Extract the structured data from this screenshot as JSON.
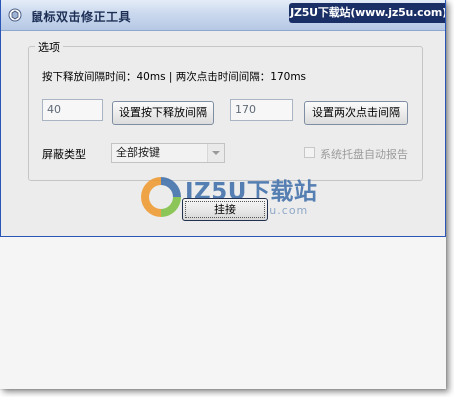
{
  "window": {
    "title": "鼠标双击修正工具",
    "watermark_text": "JZ5U下载站(www.jz5u.com)"
  },
  "options": {
    "group_label": "选项",
    "info_line": "按下释放间隔时间：40ms | 两次点击时间间隔：170ms",
    "press_interval_value": "40",
    "set_press_interval_label": "设置按下释放间隔",
    "double_click_interval_value": "170",
    "set_double_click_interval_label": "设置两次点击间隔",
    "shield_type_label": "屏蔽类型",
    "shield_type_selected": "全部按键",
    "tray_report_label": "系统托盘自动报告"
  },
  "hook_button_label": "挂接",
  "logo": {
    "text": "JZ5U下载站",
    "url": "www.jz5u.com"
  },
  "colors": {
    "titlebar_gradient_top": "#e4ecf7",
    "titlebar_gradient_bottom": "#b6c8e4",
    "watermark_bg": "#1a2f66",
    "window_bg": "#ececec",
    "logo_blue": "#3b6ba8",
    "logo_orange": "#f0962a",
    "logo_green": "#7bbf3e"
  },
  "icons": [
    "app-icon",
    "combo-arrow-icon",
    "logo-ring-icon"
  ]
}
